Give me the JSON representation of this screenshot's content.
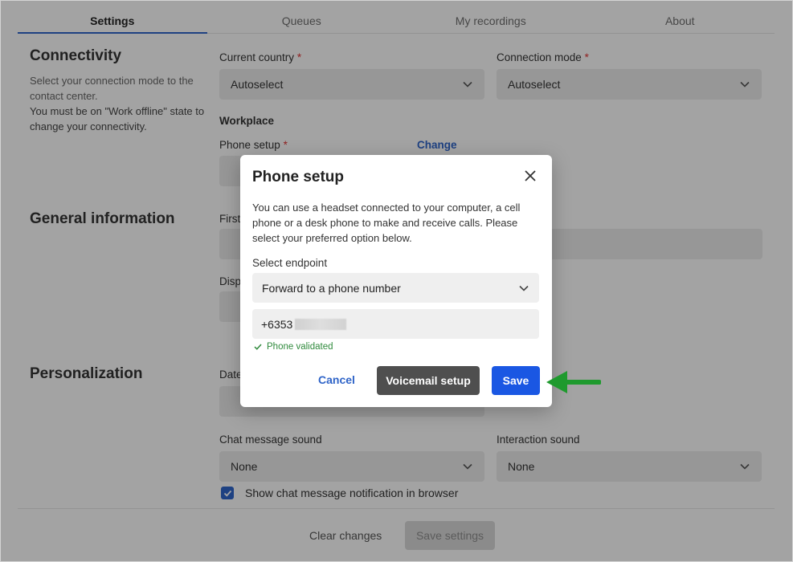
{
  "tabs": [
    {
      "label": "Settings"
    },
    {
      "label": "Queues"
    },
    {
      "label": "My recordings"
    },
    {
      "label": "About"
    }
  ],
  "sections": {
    "connectivity": {
      "title": "Connectivity",
      "desc_1": "Select your connection mode to the contact center.",
      "desc_2": "You must be on \"Work offline\" state to change your connectivity."
    },
    "general": {
      "title": "General information"
    },
    "personalization": {
      "title": "Personalization"
    }
  },
  "fields": {
    "current_country": {
      "label": "Current country",
      "required": "*",
      "value": "Autoselect"
    },
    "connection_mode": {
      "label": "Connection mode",
      "required": "*",
      "value": "Autoselect"
    },
    "workplace": {
      "label": "Workplace"
    },
    "phone_setup": {
      "label": "Phone setup",
      "required": "*",
      "change_label": "Change"
    },
    "first": {
      "label": "First"
    },
    "disp": {
      "label": "Disp"
    },
    "date": {
      "label": "Date"
    },
    "chat_sound": {
      "label": "Chat message sound",
      "value": "None"
    },
    "interaction_sound": {
      "label": "Interaction sound",
      "value": "None"
    },
    "browser_notification": {
      "label": "Show chat message notification in browser",
      "checked": true
    }
  },
  "footer": {
    "clear_label": "Clear changes",
    "save_label": "Save settings"
  },
  "modal": {
    "title": "Phone setup",
    "description": "You can use a headset connected to your computer, a cell phone or a desk phone to make and receive calls. Please select your preferred option below.",
    "endpoint_label": "Select endpoint",
    "endpoint_value": "Forward to a phone number",
    "phone_value": "+6353",
    "validated_text": "Phone validated",
    "cancel_label": "Cancel",
    "voicemail_label": "Voicemail setup",
    "save_label": "Save"
  },
  "colors": {
    "accent": "#2f64c8",
    "save_button": "#1a57e3",
    "voicemail_button": "#4f4f4f",
    "validated": "#2f8a3c",
    "annotation_arrow": "#1f9a2e"
  },
  "icons": {
    "close": "close-icon",
    "chevron": "chevron-down-icon",
    "check": "checkmark-icon",
    "annotation": "arrow-left-icon"
  }
}
